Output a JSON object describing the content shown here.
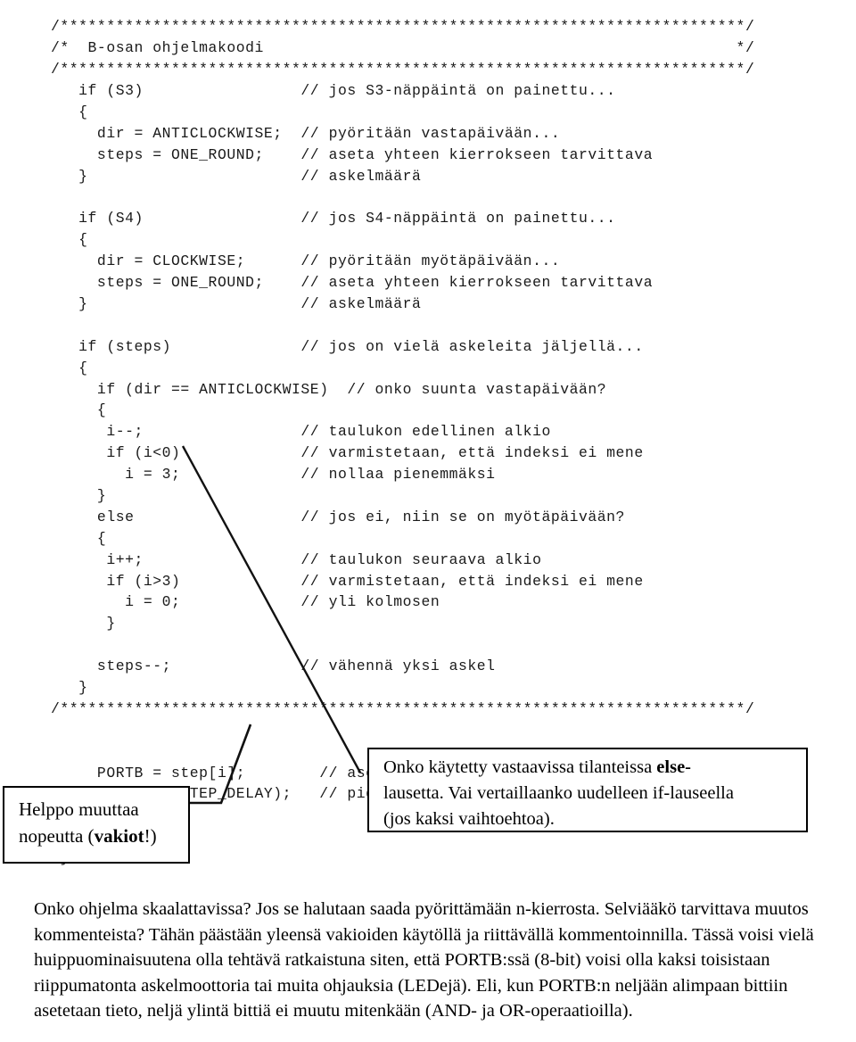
{
  "document": {
    "type": "lecture-slide",
    "language": "fi",
    "title": "B-osan ohjelmakoodi"
  },
  "code": {
    "language": "c",
    "lines": [
      "/**************************************************************************/",
      "/*  B-osan ohjelmakoodi                                                   */",
      "/**************************************************************************/",
      "   if (S3)                 // jos S3-näppäintä on painettu...",
      "   {",
      "     dir = ANTICLOCKWISE;  // pyöritään vastapäivään...",
      "     steps = ONE_ROUND;    // aseta yhteen kierrokseen tarvittava",
      "   }                       // askelmäärä",
      "",
      "   if (S4)                 // jos S4-näppäintä on painettu...",
      "   {",
      "     dir = CLOCKWISE;      // pyöritään myötäpäivään...",
      "     steps = ONE_ROUND;    // aseta yhteen kierrokseen tarvittava",
      "   }                       // askelmäärä",
      "",
      "   if (steps)              // jos on vielä askeleita jäljellä...",
      "   {",
      "     if (dir == ANTICLOCKWISE)  // onko suunta vastapäivään?",
      "     {",
      "      i--;                 // taulukon edellinen alkio",
      "      if (i<0)             // varmistetaan, että indeksi ei mene",
      "        i = 3;             // nollaa pienemmäksi",
      "     }",
      "     else                  // jos ei, niin se on myötäpäivään?",
      "     {",
      "      i++;                 // taulukon seuraava alkio",
      "      if (i>3)             // varmistetaan, että indeksi ei mene",
      "        i = 0;             // yli kolmosen",
      "      }",
      "",
      "     steps--;              // vähennä yksi askel",
      "   }",
      "/**************************************************************************/",
      "",
      "",
      "     PORTB = step[i];        // asetetaan seuraavan askeleen vaatima tieto",
      "     delay_ms(STEP_DELAY);   // pidetään tauko jokaisen askeleen välissä",
      "",
      "   };",
      " }"
    ]
  },
  "callouts": [
    {
      "id": "vakiot",
      "line1_prefix": "Helppo muuttaa",
      "line2_prefix": "nopeutta (",
      "line2_bold": "vakiot",
      "line2_suffix": "!)"
    },
    {
      "id": "else",
      "line1_prefix": "Onko käytetty vastaavissa tilanteissa ",
      "line1_bold": "else-",
      "line2": "lausetta. Vai vertaillaanko uudelleen if-lauseella",
      "line3": "(jos kaksi vaihtoehtoa)."
    }
  ],
  "bottom_text": {
    "paragraph": "Onko ohjelma skaalattavissa? Jos se halutaan saada pyörittämään n-kierrosta. Selviääkö tarvittava muutos kommenteista? Tähän päästään yleensä vakioiden käytöllä ja riittävällä kommentoinnilla. Tässä voisi vielä huippuominaisuutena olla tehtävä ratkaistuna siten, että PORTB:ssä (8-bit) voisi olla kaksi toisistaan riippumatonta askelmoottoria tai muita ohjauksia (LEDejä). Eli, kun PORTB:n neljään alimpaan bittiin asetetaan tieto, neljä ylintä bittiä ei muutu mitenkään (AND- ja OR-operaatioilla)."
  },
  "colors": {
    "text": "#1a1a1a",
    "prose": "#000000",
    "box_border": "#000000",
    "leader_line": "#111111",
    "background": "#ffffff"
  }
}
